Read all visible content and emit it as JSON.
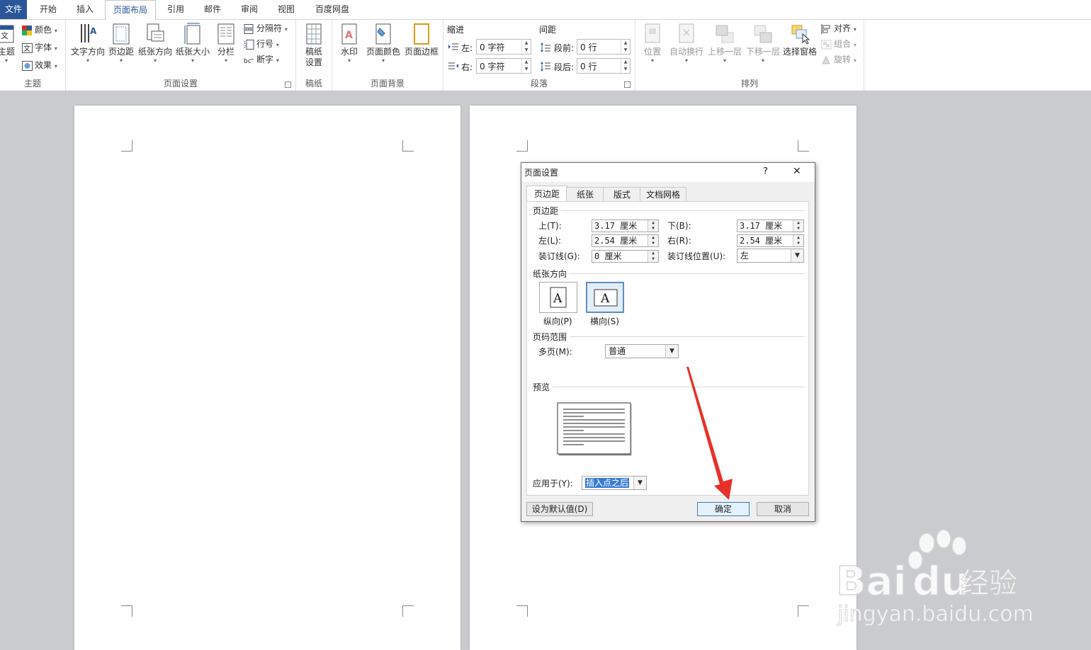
{
  "menu": {
    "tabs": [
      "文件",
      "开始",
      "插入",
      "页面布局",
      "引用",
      "邮件",
      "审阅",
      "视图",
      "百度网盘"
    ],
    "active_index": 3
  },
  "ribbon": {
    "theme": {
      "label": "主题",
      "big_button": "主题",
      "items": [
        "颜色",
        "字体",
        "效果"
      ]
    },
    "page_setup": {
      "label": "页面设置",
      "big_buttons": [
        "文字方向",
        "页边距",
        "纸张方向",
        "纸张大小",
        "分栏"
      ],
      "small_items": [
        "分隔符",
        "行号",
        "断字"
      ]
    },
    "manuscript": {
      "label": "稿纸",
      "big_button": "稿纸\n设置",
      "big_line1": "稿纸",
      "big_line2": "设置"
    },
    "page_background": {
      "label": "页面背景",
      "big_buttons": [
        "水印",
        "页面颜色",
        "页面边框"
      ]
    },
    "paragraph": {
      "label": "段落",
      "indent_title": "缩进",
      "spacing_title": "间距",
      "indent_left_label": "左:",
      "indent_left_value": "0 字符",
      "indent_right_label": "右:",
      "indent_right_value": "0 字符",
      "spacing_before_label": "段前:",
      "spacing_before_value": "0 行",
      "spacing_after_label": "段后:",
      "spacing_after_value": "0 行"
    },
    "arrange": {
      "label": "排列",
      "big_buttons": [
        "位置",
        "自动换行",
        "上移一层",
        "下移一层",
        "选择窗格"
      ],
      "small_items": [
        "对齐",
        "组合",
        "旋转"
      ]
    }
  },
  "dialog": {
    "title": "页面设置",
    "help": "?",
    "close": "✕",
    "tabs": [
      "页边距",
      "纸张",
      "版式",
      "文档网格"
    ],
    "active_tab": 0,
    "margins_section": "页边距",
    "top_label": "上(T):",
    "top_value": "3.17 厘米",
    "bottom_label": "下(B):",
    "bottom_value": "3.17 厘米",
    "left_label": "左(L):",
    "left_value": "2.54 厘米",
    "right_label": "右(R):",
    "right_value": "2.54 厘米",
    "gutter_label": "装订线(G):",
    "gutter_value": "0 厘米",
    "gutter_pos_label": "装订线位置(U):",
    "gutter_pos_value": "左",
    "orientation_section": "纸张方向",
    "portrait_label": "纵向(P)",
    "landscape_label": "横向(S)",
    "orientation_glyph": "A",
    "pages_section": "页码范围",
    "multi_pages_label": "多页(M):",
    "multi_pages_value": "普通",
    "preview_section": "预览",
    "apply_to_label": "应用于(Y):",
    "apply_to_value": "插入点之后",
    "set_default_button": "设为默认值(D)",
    "ok_button": "确定",
    "cancel_button": "取消"
  },
  "colors": {
    "file_tab": "#2b579a",
    "arrow": "#e8302a",
    "selection": "#3a7bd5"
  }
}
